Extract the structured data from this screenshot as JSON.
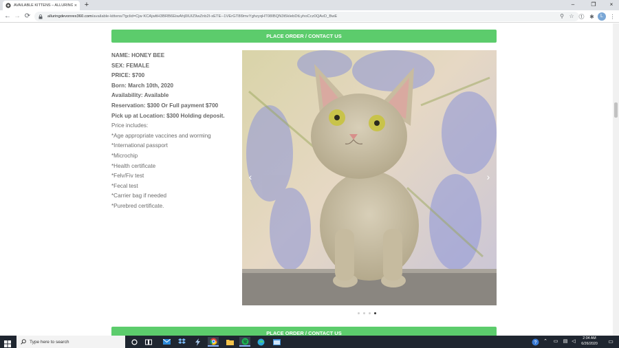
{
  "browser": {
    "tab_title": "AVAILABLE KITTENS – ALLURING",
    "tab_close": "×",
    "new_tab": "+",
    "window_min": "–",
    "window_max": "❐",
    "window_close": "×",
    "back": "←",
    "forward": "→",
    "reload": "⟳",
    "url_host": "alluringdevonrex360.com",
    "url_path": "/available-kittens/?gclid=Cjw KCAjwltH3BRB6EiwAhj0IUIZ9wZnb2I-xETE--1VErGT8l9mvYghzyqHT08IBQN3t5kIebDtLyhoCcz0QAvD_BwE",
    "zoom_icon": "⚲",
    "star_icon": "☆",
    "ext_icon_1": "⓵",
    "ext_icon_2": "✱",
    "avatar_letter": "L",
    "menu_icon": "⋮"
  },
  "page": {
    "order_button_label": "PLACE ORDER / CONTACT US",
    "details": [
      {
        "text": "NAME: HONEY BEE",
        "bold": true
      },
      {
        "text": "SEX: FEMALE",
        "bold": true
      },
      {
        "text": "PRICE: $700",
        "bold": true
      },
      {
        "text": "Born: March 10th, 2020",
        "bold": true
      },
      {
        "text": "Availability: Available",
        "bold": true
      },
      {
        "text": "Reservation: $300 Or Full payment $700",
        "bold": true
      },
      {
        "text": "Pick up at Location: $300 Holding deposit.",
        "bold": true
      },
      {
        "text": "Price includes:",
        "bold": false
      },
      {
        "text": "*Age appropriate vaccines and worming",
        "bold": false
      },
      {
        "text": "*International passport",
        "bold": false
      },
      {
        "text": "*Microchip",
        "bold": false
      },
      {
        "text": "*Health certificate",
        "bold": false
      },
      {
        "text": "*Felv/Fiv test",
        "bold": false
      },
      {
        "text": "*Fecal test",
        "bold": false
      },
      {
        "text": "*Carrier bag if needed",
        "bold": false
      },
      {
        "text": "*Purebred certificate.",
        "bold": false
      }
    ],
    "carousel": {
      "prev": "‹",
      "next": "›",
      "slide_count": 4,
      "active_index": 3
    }
  },
  "taskbar": {
    "search_placeholder": "Type here to search",
    "time": "2:04 AM",
    "date": "6/26/2020",
    "notification_icon": "▭"
  },
  "colors": {
    "accent_green": "#5ccc6c",
    "taskbar": "#1f2630"
  }
}
